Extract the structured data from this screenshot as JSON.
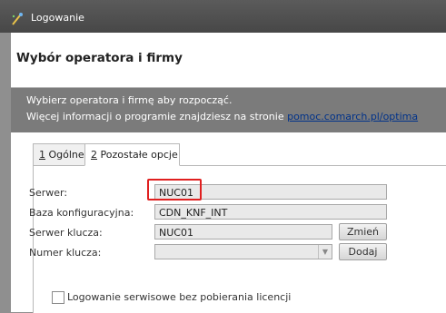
{
  "window": {
    "title": "Logowanie",
    "icon": "app-wand-icon"
  },
  "header": {
    "title": "Wybór operatora i firmy"
  },
  "info": {
    "line1": "Wybierz operatora i firmę aby rozpocząć.",
    "line2_prefix": "Więcej informacji o programie znajdziesz na stronie ",
    "link": "pomoc.comarch.pl/optima"
  },
  "tabs": [
    {
      "key": "1",
      "rest": " Ogólne"
    },
    {
      "key": "2",
      "rest": " Pozostałe opcje"
    }
  ],
  "form": {
    "server_label": "Serwer:",
    "server_value": "NUC01",
    "config_db_label": "Baza konfiguracyjna:",
    "config_db_value": "CDN_KNF_INT",
    "key_server_label": "Serwer klucza:",
    "key_server_value": "NUC01",
    "change_button": "Zmień",
    "key_number_label": "Numer klucza:",
    "key_number_value": "",
    "add_button": "Dodaj",
    "service_login_label": "Logowanie serwisowe bez pobierania licencji"
  }
}
